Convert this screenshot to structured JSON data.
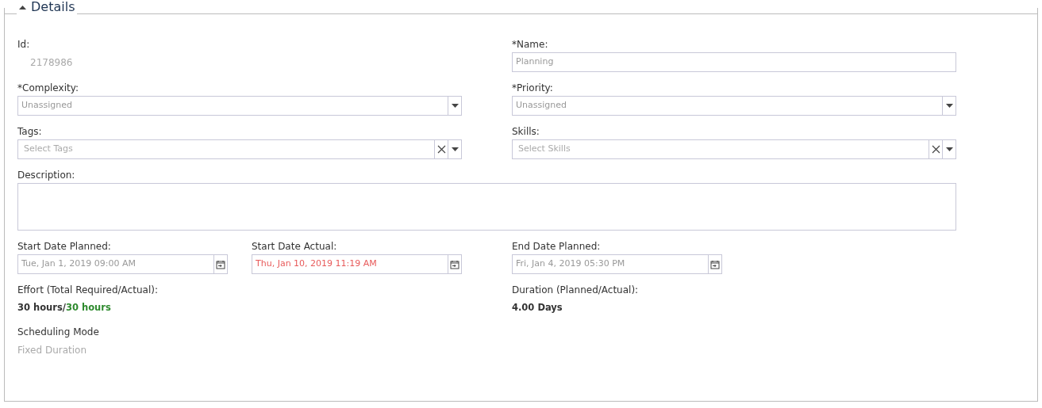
{
  "section": {
    "title": "Details",
    "expanded": true
  },
  "rows": [
    {
      "kind": "pair",
      "fields": [
        {
          "label": "Id:",
          "kind": "static",
          "value": "2178986"
        },
        {
          "label": "*Name:",
          "kind": "text",
          "value": "Planning"
        }
      ]
    },
    {
      "kind": "pair",
      "fields": [
        {
          "label": "*Complexity:",
          "kind": "select",
          "value": "Unassigned"
        },
        {
          "label": "*Priority:",
          "kind": "select",
          "value": "Unassigned"
        }
      ]
    },
    {
      "kind": "pair",
      "fields": [
        {
          "label": "Tags:",
          "kind": "multiselect",
          "placeholder": "Select Tags"
        },
        {
          "label": "Skills:",
          "kind": "multiselect",
          "placeholder": "Select Skills"
        }
      ]
    },
    {
      "kind": "full",
      "fields": [
        {
          "label": "Description:",
          "kind": "textarea"
        }
      ]
    }
  ],
  "dates": [
    {
      "label": "Start Date Planned:",
      "value": "Tue, Jan 1, 2019 09:00 AM",
      "overdue": false
    },
    {
      "label": "Start Date Actual:",
      "value": "Thu, Jan 10, 2019 11:19 AM",
      "overdue": true
    },
    {
      "label": "End Date Planned:",
      "value": "Fri, Jan 4, 2019 05:30 PM",
      "overdue": false
    }
  ],
  "effort": {
    "label": "Effort (Total Required/Actual):",
    "required": "30 hours/",
    "actual": "30 hours",
    "on_track": true
  },
  "duration": {
    "label": "Duration (Planned/Actual):",
    "value": "4.00 Days"
  },
  "scheduling": {
    "label": "Scheduling Mode",
    "value": "Fixed Duration"
  }
}
